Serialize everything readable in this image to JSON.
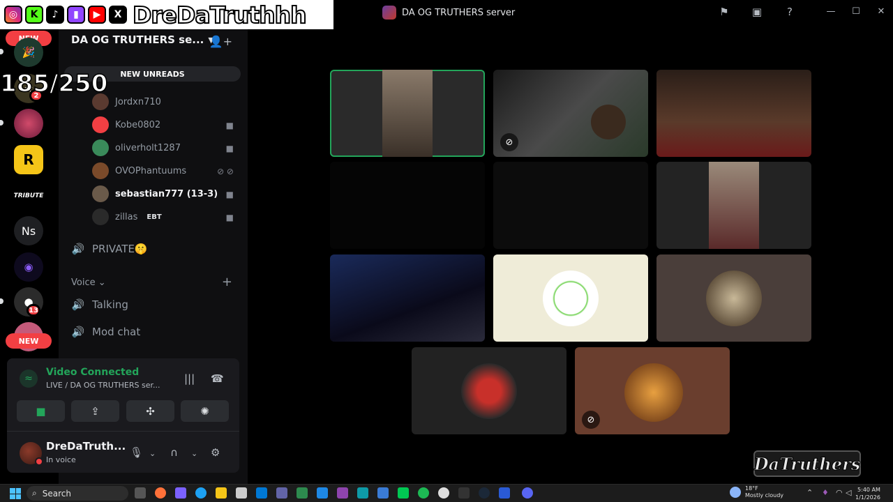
{
  "window": {
    "server_title": "DA OG TRUTHERS server",
    "controls": [
      "flag-icon",
      "inbox-icon",
      "help-icon",
      "minimize-icon",
      "maximize-icon",
      "close-icon"
    ]
  },
  "overlay": {
    "banner_text": "DreDaTruthhh",
    "socials": [
      "instagram",
      "kick",
      "tiktok",
      "twitch",
      "youtube",
      "x"
    ],
    "viewer_count": "185/250"
  },
  "rail": {
    "new_top": "NEW",
    "new_bottom": "NEW",
    "badge_1": "2",
    "badge_2": "13",
    "tribute_label": "TRIBUTE",
    "ns_label": "Ns"
  },
  "sidebar": {
    "server_name": "DA OG TRUTHERS se...",
    "new_unreads": "NEW UNREADS",
    "members": [
      {
        "name": "Jordxn710"
      },
      {
        "name": "Kobe0802"
      },
      {
        "name": "oliverholt1287"
      },
      {
        "name": "OVOPhantuums"
      },
      {
        "name": "sebastian777 (13-3)"
      },
      {
        "name": "zillas",
        "tag": "EBT"
      }
    ],
    "channel_private": "PRIVATE🤫",
    "category_voice": "Voice",
    "channel_talking": "Talking",
    "channel_mod": "Mod chat"
  },
  "voice_panel": {
    "status": "Video Connected",
    "location": "LIVE / DA OG TRUTHERS ser...",
    "user_name": "DreDaTruth...",
    "user_status": "In voice"
  },
  "watermark": "DaTruthers",
  "taskbar": {
    "search_label": "Search",
    "temperature": "18°F",
    "weather": "Mostly cloudy",
    "time": "5:40 AM",
    "date": "1/1/2026"
  },
  "colors": {
    "accent_green": "#23a55a",
    "danger_red": "#f23f43",
    "sidebar_bg": "#0f0f11",
    "panel_bg": "#1a1a1e"
  }
}
